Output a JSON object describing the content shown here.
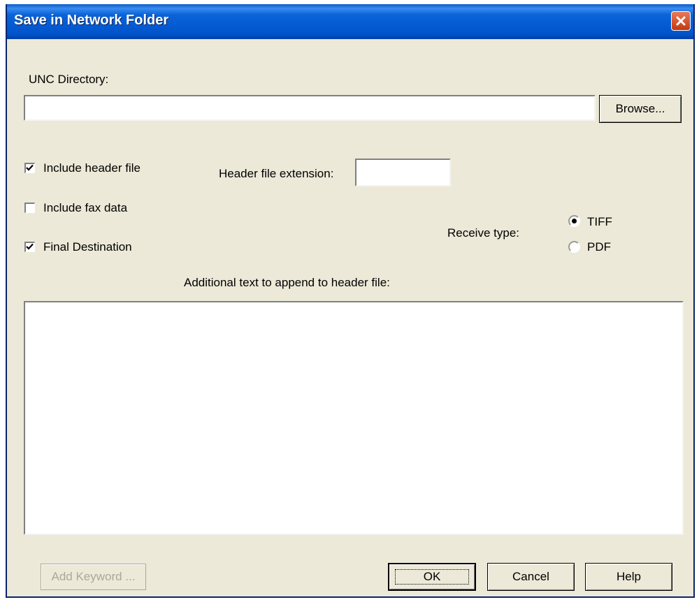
{
  "window": {
    "title": "Save in Network Folder"
  },
  "unc": {
    "label": "UNC Directory:",
    "value": "",
    "browse_label": "Browse..."
  },
  "options": {
    "include_header": {
      "label": "Include header file",
      "checked": true
    },
    "include_fax": {
      "label": "Include fax data",
      "checked": false
    },
    "final_destination": {
      "label": "Final Destination",
      "checked": true
    }
  },
  "header_ext": {
    "label": "Header file extension:",
    "value": ""
  },
  "receive_type": {
    "label": "Receive type:",
    "options": [
      {
        "label": "TIFF",
        "selected": true
      },
      {
        "label": "PDF",
        "selected": false
      }
    ]
  },
  "additional_text": {
    "label": "Additional text to append to header file:",
    "value": ""
  },
  "buttons": {
    "add_keyword": "Add Keyword ...",
    "ok": "OK",
    "cancel": "Cancel",
    "help": "Help"
  },
  "icons": {
    "close": "close-icon",
    "check": "checkmark-icon",
    "radio_dot": "radio-dot-icon"
  },
  "colors": {
    "titlebar": "#0054cc",
    "dialog_bg": "#ece9d8",
    "close_button": "#c43810"
  }
}
